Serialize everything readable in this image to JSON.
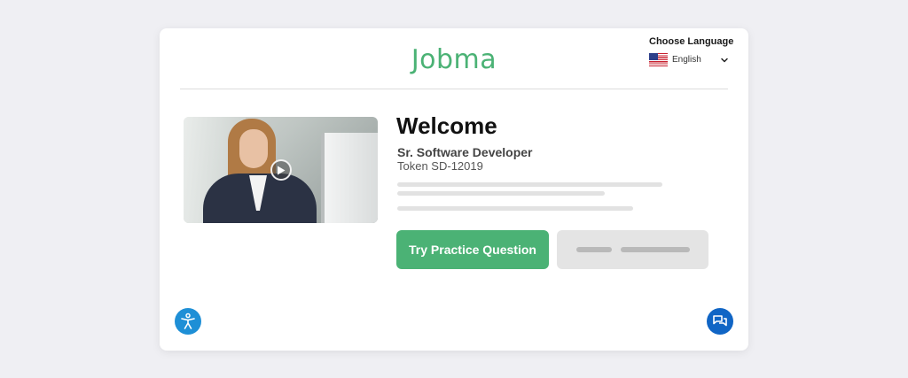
{
  "brand": {
    "logo_text": "Jobma",
    "color": "#4bb275"
  },
  "language": {
    "heading": "Choose Language",
    "selected": "English",
    "flag_icon": "us-flag-icon"
  },
  "intro": {
    "heading": "Welcome",
    "job_title": "Sr. Software Developer",
    "token": "Token SD-12019"
  },
  "video": {
    "play_icon": "play-icon"
  },
  "actions": {
    "primary_label": "Try Practice Question",
    "primary_color": "#4bb275",
    "secondary_color": "#e4e4e4"
  },
  "floating": {
    "accessibility_icon": "accessibility-icon",
    "accessibility_color": "#1e8fd6",
    "chat_icon": "chat-icon",
    "chat_color": "#1065c5"
  }
}
